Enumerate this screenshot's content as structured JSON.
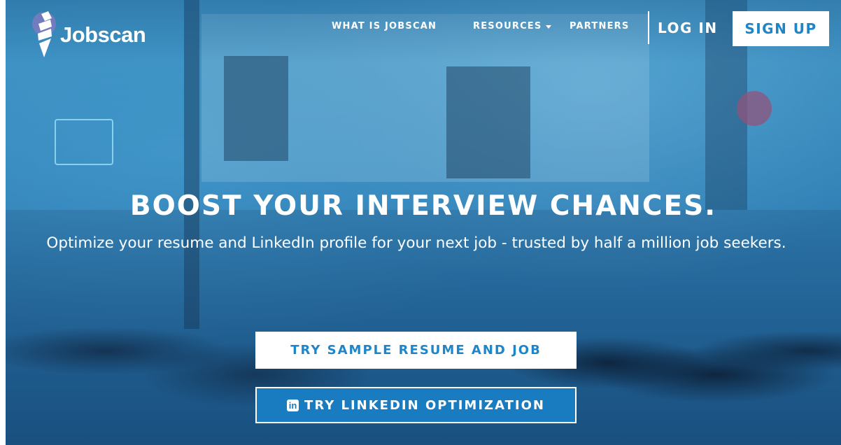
{
  "brand": {
    "name": "Jobscan",
    "accent_color": "#1e86c8",
    "overlay_color": "#2896d2"
  },
  "nav": {
    "what_is": "WHAT IS JOBSCAN",
    "resources": "RESOURCES",
    "partners": "PARTNERS",
    "login": "LOG IN",
    "signup": "SIGN UP"
  },
  "hero": {
    "headline": "BOOST YOUR INTERVIEW CHANCES.",
    "subline": "Optimize your resume and LinkedIn profile for your next job - trusted by half a million job seekers.",
    "sample_button": "TRY SAMPLE RESUME AND JOB",
    "linkedin_button": "TRY LINKEDIN OPTIMIZATION",
    "linkedin_icon": "in"
  },
  "icons": {
    "logo": "tie-icon",
    "resources_caret": "caret-down-icon",
    "linkedin": "linkedin-icon"
  }
}
